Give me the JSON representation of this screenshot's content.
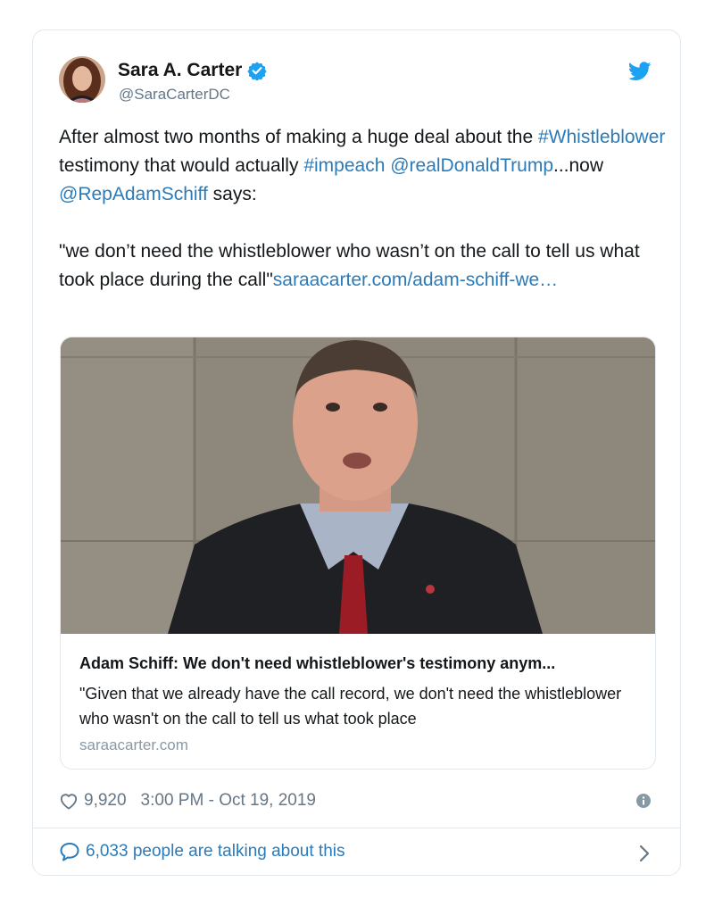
{
  "user": {
    "display_name": "Sara A. Carter",
    "handle": "@SaraCarterDC",
    "verified": true
  },
  "tweet": {
    "line1_before": "After almost two months of making a huge deal about the ",
    "hashtag_whistleblower": "#Whistleblower",
    "line2_mid": " testimony that would actually ",
    "hashtag_impeach": "#impeach",
    "mention_trump": "@realDonaldTrump",
    "text_now": "...now ",
    "mention_schiff": "@RepAdamSchiff",
    "text_says": " says:",
    "quote": "\"we don’t need the whistleblower who wasn’t on the call to tell us what took place during the call\"",
    "link_text": "saraacarter.com/adam-schiff-we…"
  },
  "card": {
    "title": "Adam Schiff: We don't need whistleblower's testimony anym...",
    "description": "\"Given that we already have the call record, we don't need the whistleblower who wasn't on the call to tell us what took place",
    "domain": "saraacarter.com"
  },
  "footer": {
    "likes": "9,920",
    "timestamp": "3:00 PM - Oct 19, 2019",
    "talking": "6,033 people are talking about this"
  },
  "colors": {
    "link": "#2b7bb9",
    "twitter_blue": "#1da1f2",
    "muted": "#657786",
    "border": "#e1e8ed"
  },
  "icons": [
    "verified-badge-icon",
    "twitter-bird-icon",
    "heart-icon",
    "info-icon",
    "speech-bubble-icon",
    "chevron-right-icon"
  ]
}
